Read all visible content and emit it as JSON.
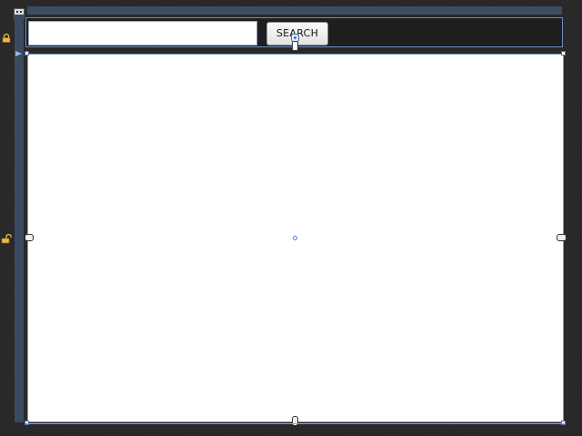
{
  "search": {
    "input_value": "",
    "button_label": "SEARCH"
  },
  "icons": {
    "move_handle": "move-grip-icon",
    "lock": "padlock-icon",
    "anchor": "anchor-handle-icon",
    "center_marker": "center-dot-icon"
  },
  "colors": {
    "selection_border": "#7f9ad4",
    "chrome_strip": "#3b4c63",
    "canvas_background": "#262626"
  }
}
